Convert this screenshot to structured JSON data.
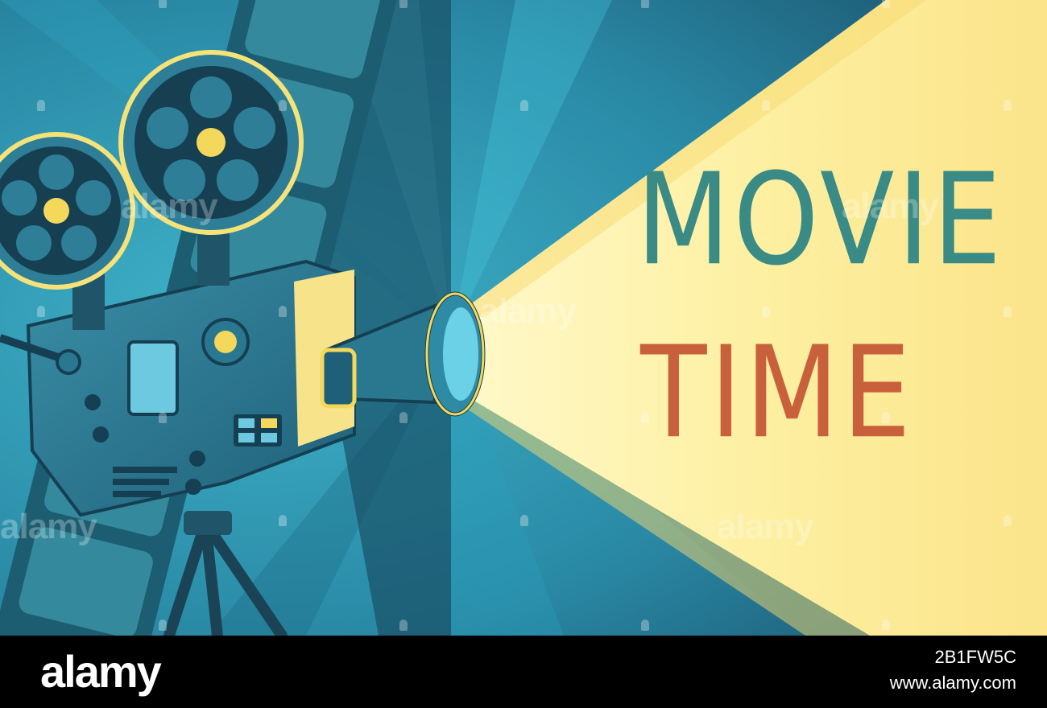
{
  "poster": {
    "title_line_1": "MOVIE",
    "title_line_2": "TIME",
    "colors": {
      "background": "#1f5f79",
      "light_beam": "#fdf2a8",
      "title_line_1": "#3a8a85",
      "title_line_2": "#c8613b",
      "projector_body": "#2e7d95",
      "reel_outline": "#f5e37a"
    },
    "watermark_text": "alamy"
  },
  "footer": {
    "logo": "alamy",
    "image_id": "2B1FW5C",
    "url": "www.alamy.com"
  }
}
